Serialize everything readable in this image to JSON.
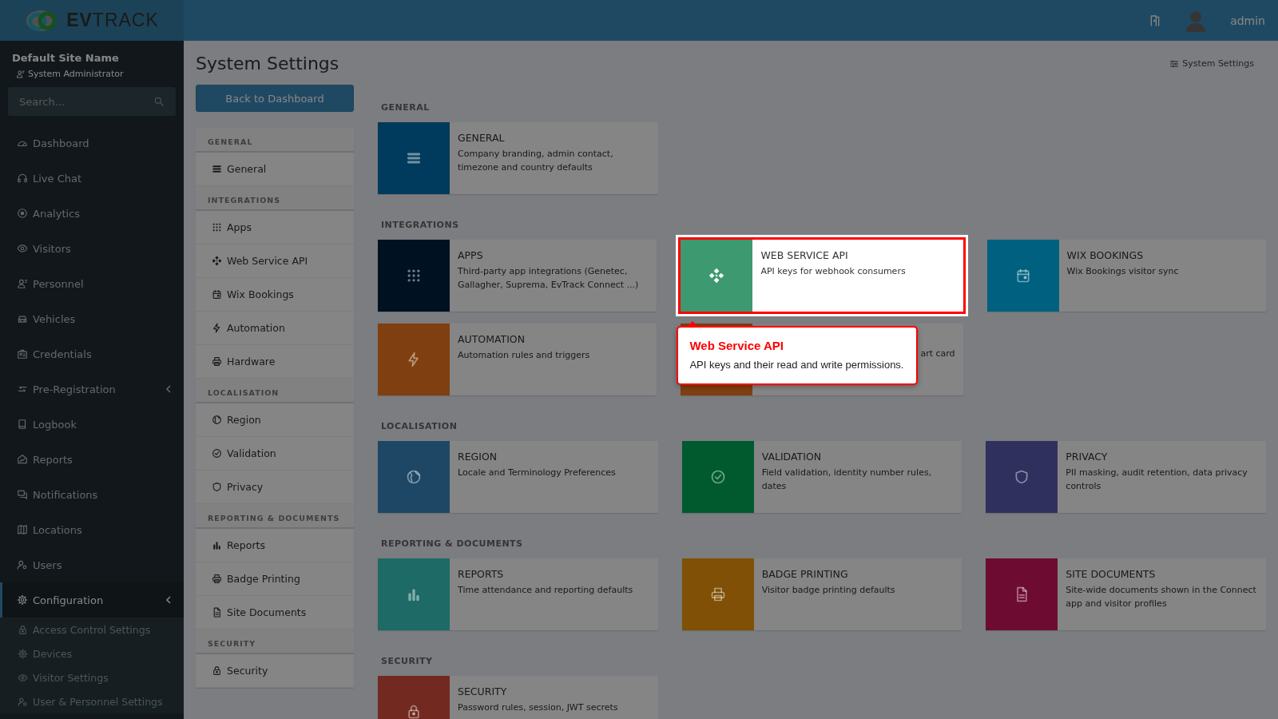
{
  "topbar": {
    "logo": "**EV**TRACK",
    "user": "admin"
  },
  "sidebar": {
    "site_name": "Default Site Name",
    "role": "System Administrator",
    "search_placeholder": "Search...",
    "items": [
      {
        "label": "Dashboard",
        "selected": false,
        "expandable": false
      },
      {
        "label": "Live Chat",
        "selected": false,
        "expandable": false
      },
      {
        "label": "Analytics",
        "selected": false,
        "expandable": false
      },
      {
        "label": "Visitors",
        "selected": false,
        "expandable": false
      },
      {
        "label": "Personnel",
        "selected": false,
        "expandable": false
      },
      {
        "label": "Vehicles",
        "selected": false,
        "expandable": false
      },
      {
        "label": "Credentials",
        "selected": false,
        "expandable": false
      },
      {
        "label": "Pre-Registration",
        "selected": false,
        "expandable": true
      },
      {
        "label": "Logbook",
        "selected": false,
        "expandable": false
      },
      {
        "label": "Reports",
        "selected": false,
        "expandable": false
      },
      {
        "label": "Notifications",
        "selected": false,
        "expandable": false
      },
      {
        "label": "Locations",
        "selected": false,
        "expandable": false
      },
      {
        "label": "Users",
        "selected": false,
        "expandable": false
      },
      {
        "label": "Configuration",
        "selected": true,
        "expandable": true,
        "children": [
          {
            "label": "Access Control Settings"
          },
          {
            "label": "Devices"
          },
          {
            "label": "Visitor Settings"
          },
          {
            "label": "User & Personnel Settings"
          }
        ]
      }
    ]
  },
  "page": {
    "title": "System Settings",
    "breadcrumb": "System Settings",
    "back_button": "Back to Dashboard"
  },
  "settings_nav": [
    {
      "heading": "GENERAL",
      "items": [
        "General"
      ]
    },
    {
      "heading": "INTEGRATIONS",
      "items": [
        "Apps",
        "Web Service API",
        "Wix Bookings",
        "Automation",
        "Hardware"
      ]
    },
    {
      "heading": "LOCALISATION",
      "items": [
        "Region",
        "Validation",
        "Privacy"
      ]
    },
    {
      "heading": "REPORTING & DOCUMENTS",
      "items": [
        "Reports",
        "Badge Printing",
        "Site Documents"
      ]
    },
    {
      "heading": "SECURITY",
      "items": [
        "Security"
      ]
    }
  ],
  "sections": [
    {
      "heading": "GENERAL",
      "cards": [
        {
          "kind": "card",
          "title": "GENERAL",
          "description": "Company branding, admin contact, timezone and country defaults",
          "color": "#003a5c",
          "highlighted": false
        }
      ]
    },
    {
      "heading": "INTEGRATIONS",
      "cards": [
        {
          "kind": "card",
          "title": "APPS",
          "description": "Third-party app integrations (Genetec, Gallagher, Suprema, EvTrack Connect ...)",
          "color": "#001122",
          "highlighted": false
        },
        {
          "kind": "card",
          "title": "WEB SERVICE API",
          "description": "API keys for webhook consumers",
          "color": "#3d9970",
          "highlighted": true
        },
        {
          "kind": "card",
          "title": "WIX BOOKINGS",
          "description": "Wix Bookings visitor sync",
          "color": "#006080",
          "highlighted": false
        },
        {
          "kind": "card",
          "title": "AUTOMATION",
          "description": "Automation rules and triggers",
          "color": "#7f3f10",
          "highlighted": false
        },
        {
          "kind": "covered",
          "description": "art card",
          "color": "#7f3f10"
        }
      ]
    },
    {
      "heading": "LOCALISATION",
      "cards": [
        {
          "kind": "card",
          "title": "REGION",
          "description": "Locale and Terminology Preferences",
          "color": "#1e4766",
          "highlighted": false
        },
        {
          "kind": "card",
          "title": "VALIDATION",
          "description": "Field validation, identity number rules, dates",
          "color": "#005a2e",
          "highlighted": false
        },
        {
          "kind": "card",
          "title": "PRIVACY",
          "description": "PII masking, audit retention, data privacy controls",
          "color": "#30305e",
          "highlighted": false
        }
      ]
    },
    {
      "heading": "REPORTING & DOCUMENTS",
      "cards": [
        {
          "kind": "card",
          "title": "REPORTS",
          "description": "Time attendance and reporting defaults",
          "color": "#1d6a66",
          "highlighted": false
        },
        {
          "kind": "card",
          "title": "BADGE PRINTING",
          "description": "Visitor badge printing defaults",
          "color": "#7f5005",
          "highlighted": false
        },
        {
          "kind": "card",
          "title": "SITE DOCUMENTS",
          "description": "Site-wide documents shown in the Connect app and visitor profiles",
          "color": "#6d0c30",
          "highlighted": false
        }
      ]
    },
    {
      "heading": "SECURITY",
      "cards": [
        {
          "kind": "card",
          "title": "SECURITY",
          "description": "Password rules, session, JWT secrets",
          "color": "#722a20",
          "highlighted": false
        }
      ]
    }
  ],
  "tour_tooltip": {
    "title": "Web Service API",
    "text": "API keys and their read and write permissions."
  }
}
